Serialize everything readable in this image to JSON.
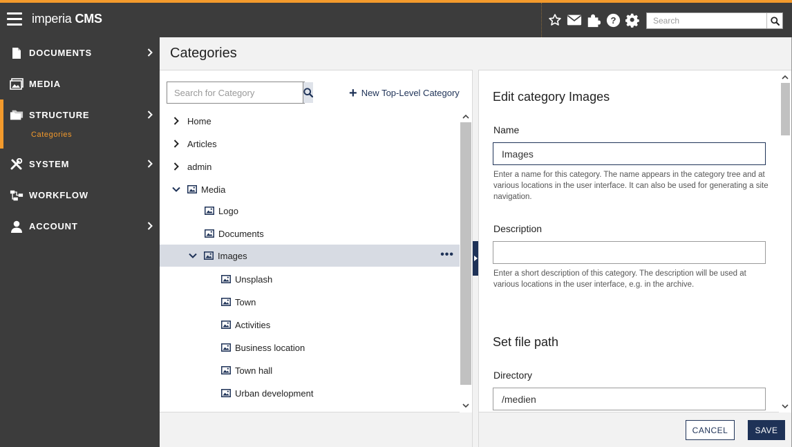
{
  "app": {
    "brand_regular": "imperia",
    "brand_bold": "CMS",
    "accent_color": "#f39a2c",
    "primary_color": "#1e3257"
  },
  "topbar": {
    "icons": [
      "star-icon",
      "mail-icon",
      "puzzle-icon",
      "help-icon",
      "gear-icon"
    ],
    "search_placeholder": "Search"
  },
  "sidebar": {
    "items": [
      {
        "label": "DOCUMENTS",
        "icon": "document-icon",
        "has_children": true
      },
      {
        "label": "MEDIA",
        "icon": "image-icon",
        "has_children": false
      },
      {
        "label": "STRUCTURE",
        "icon": "folders-icon",
        "has_children": true,
        "active": true,
        "sub_label": "Categories"
      },
      {
        "label": "SYSTEM",
        "icon": "tools-icon",
        "has_children": true
      },
      {
        "label": "WORKFLOW",
        "icon": "workflow-icon",
        "has_children": false
      },
      {
        "label": "ACCOUNT",
        "icon": "user-icon",
        "has_children": true
      }
    ]
  },
  "page": {
    "title": "Categories"
  },
  "tree_panel": {
    "search_placeholder": "Search for Category",
    "new_category_label": "New Top-Level Category",
    "rows": [
      {
        "label": "Home",
        "level": 0,
        "expander": "collapsed",
        "has_icon": false
      },
      {
        "label": "Articles",
        "level": 0,
        "expander": "collapsed",
        "has_icon": false
      },
      {
        "label": "admin",
        "level": 0,
        "expander": "collapsed",
        "has_icon": false
      },
      {
        "label": "Media",
        "level": 0,
        "expander": "expanded",
        "has_icon": true
      },
      {
        "label": "Logo",
        "level": 1,
        "expander": "none",
        "has_icon": true
      },
      {
        "label": "Documents",
        "level": 1,
        "expander": "none",
        "has_icon": true
      },
      {
        "label": "Images",
        "level": 1,
        "expander": "expanded",
        "has_icon": true,
        "selected": true
      },
      {
        "label": "Unsplash",
        "level": 2,
        "expander": "none",
        "has_icon": true
      },
      {
        "label": "Town",
        "level": 2,
        "expander": "none",
        "has_icon": true
      },
      {
        "label": "Activities",
        "level": 2,
        "expander": "none",
        "has_icon": true
      },
      {
        "label": "Business location",
        "level": 2,
        "expander": "none",
        "has_icon": true
      },
      {
        "label": "Town hall",
        "level": 2,
        "expander": "none",
        "has_icon": true
      },
      {
        "label": "Urban development",
        "level": 2,
        "expander": "none",
        "has_icon": true
      }
    ]
  },
  "edit_panel": {
    "heading": "Edit category Images",
    "name_label": "Name",
    "name_value": "Images",
    "name_help": "Enter a name for this category. The name appears in the category tree and at various locations in the user interface. It can also be used for generating a site navigation.",
    "description_label": "Description",
    "description_value": "",
    "description_help": "Enter a short description of this category. The description will be used at various locations in the user interface, e.g. in the archive.",
    "file_path_heading": "Set file path",
    "directory_label": "Directory",
    "directory_value": "/medien"
  },
  "footer": {
    "cancel_label": "CANCEL",
    "save_label": "SAVE"
  }
}
